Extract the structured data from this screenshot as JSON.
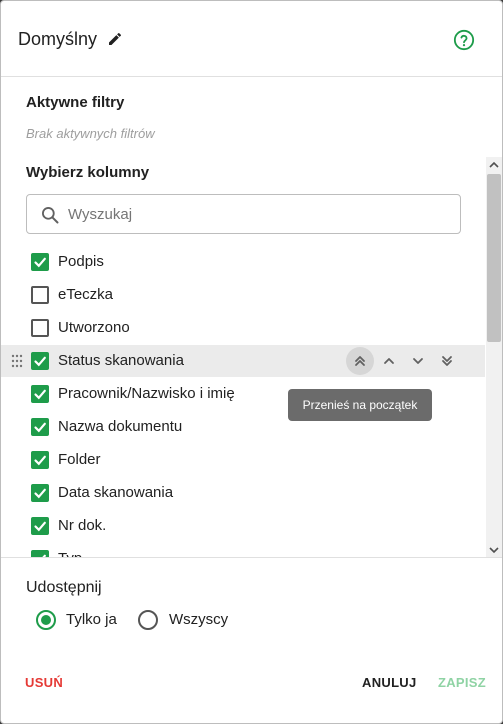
{
  "header": {
    "title": "Domyślny"
  },
  "filters": {
    "title": "Aktywne filtry",
    "empty": "Brak aktywnych filtrów"
  },
  "columns": {
    "title": "Wybierz kolumny",
    "search_placeholder": "Wyszukaj",
    "items": [
      {
        "label": "Podpis",
        "checked": true
      },
      {
        "label": "eTeczka",
        "checked": false
      },
      {
        "label": "Utworzono",
        "checked": false
      },
      {
        "label": "Status skanowania",
        "checked": true
      },
      {
        "label": "Pracownik/Nazwisko i imię",
        "checked": true
      },
      {
        "label": "Nazwa dokumentu",
        "checked": true
      },
      {
        "label": "Folder",
        "checked": true
      },
      {
        "label": "Data skanowania",
        "checked": true
      },
      {
        "label": "Nr dok.",
        "checked": true
      },
      {
        "label": "Typ",
        "checked": true
      }
    ]
  },
  "tooltip": "Przenieś na początek",
  "share": {
    "title": "Udostępnij",
    "options": [
      {
        "label": "Tylko ja",
        "selected": true
      },
      {
        "label": "Wszyscy",
        "selected": false
      }
    ]
  },
  "actions": {
    "delete": "USUŃ",
    "cancel": "ANULUJ",
    "save": "ZAPISZ"
  },
  "colors": {
    "accent": "#1e9c4a",
    "danger": "#e53935",
    "disabled_accent": "#8fd3a4"
  }
}
